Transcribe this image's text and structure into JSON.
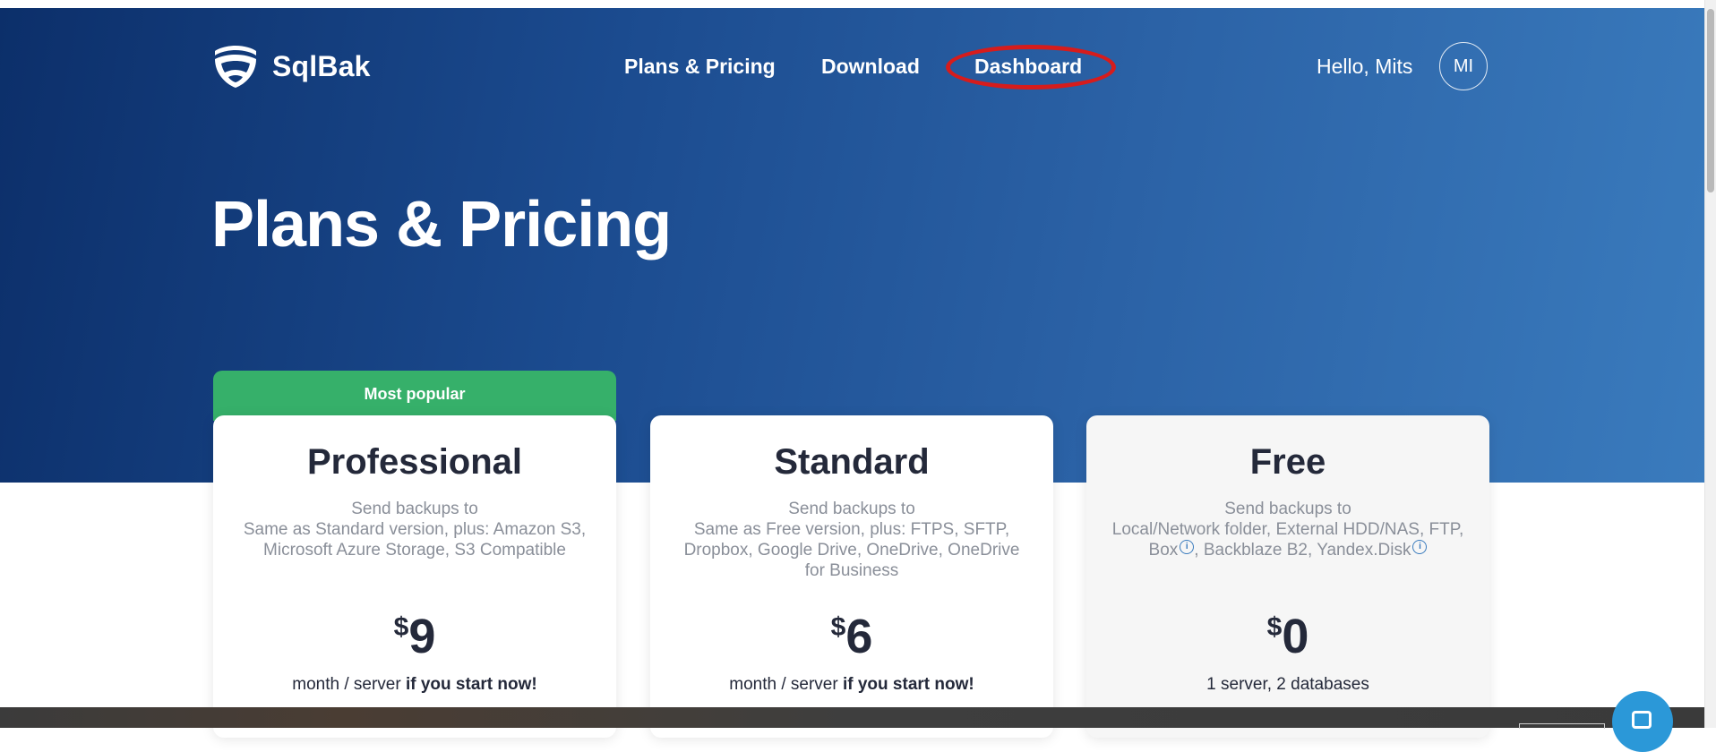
{
  "header": {
    "logo_text": "SqlBak",
    "nav": [
      {
        "label": "Plans & Pricing"
      },
      {
        "label": "Download"
      },
      {
        "label": "Dashboard"
      }
    ],
    "greeting": "Hello, Mits",
    "avatar_initials": "MI"
  },
  "hero": {
    "title": "Plans & Pricing"
  },
  "plans": [
    {
      "badge": "Most popular",
      "name": "Professional",
      "desc_line1": "Send backups to",
      "desc_rest": "Same as Standard version, plus: Amazon S3, Microsoft Azure Storage, S3 Compatible",
      "currency": "$",
      "price": "9",
      "per_text": "month / server",
      "per_bold": "if you start now!"
    },
    {
      "name": "Standard",
      "desc_line1": "Send backups to",
      "desc_rest": "Same as Free version, plus: FTPS, SFTP, Dropbox, Google Drive, OneDrive, OneDrive for Business",
      "currency": "$",
      "price": "6",
      "per_text": "month / server",
      "per_bold": "if you start now!"
    },
    {
      "name": "Free",
      "desc_line1": "Send backups to",
      "desc_part_a": "Local/Network folder, External HDD/NAS, FTP, Box",
      "desc_part_b": ", Backblaze B2, Yandex.Disk",
      "currency": "$",
      "price": "0",
      "per_text": "1 server, 2 databases"
    }
  ],
  "colors": {
    "hero_start": "#0c2f6a",
    "hero_end": "#3a7bbd",
    "badge_green": "#36b06a",
    "highlight_red": "#d61c1c",
    "chat_blue": "#2b98d8"
  },
  "icons": {
    "logo": "shield-logo-icon",
    "info": "info-circle-icon",
    "chat": "chat-bubble-icon"
  }
}
